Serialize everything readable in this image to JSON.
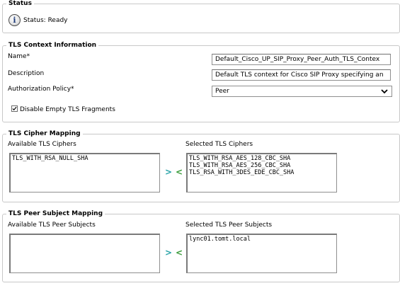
{
  "status": {
    "legend": "Status",
    "text": "Status: Ready",
    "icon": "info-icon"
  },
  "tls_context": {
    "legend": "TLS Context Information",
    "name_label": "Name",
    "name_value": "Default_Cisco_UP_SIP_Proxy_Peer_Auth_TLS_Contex",
    "description_label": "Description",
    "description_value": "Default TLS context for Cisco SIP Proxy specifying an",
    "auth_policy_label": "Authorization Policy",
    "auth_policy_value": "Peer",
    "required_marker": "*",
    "disable_empty_fragments_label": "Disable Empty TLS Fragments",
    "disable_empty_fragments_checked": true
  },
  "cipher_mapping": {
    "legend": "TLS Cipher Mapping",
    "available_label": "Available TLS Ciphers",
    "available": [
      "TLS_WITH_RSA_NULL_SHA"
    ],
    "selected_label": "Selected TLS Ciphers",
    "selected": [
      "TLS_WITH_RSA_AES_128_CBC_SHA",
      "TLS_WITH_RSA_AES_256_CBC_SHA",
      "TLS_RSA_WITH_3DES_EDE_CBC_SHA"
    ],
    "move_right": ">",
    "move_left": "<"
  },
  "peer_subject_mapping": {
    "legend": "TLS Peer Subject Mapping",
    "available_label": "Available TLS Peer Subjects",
    "available": [],
    "selected_label": "Selected TLS Peer Subjects",
    "selected": [
      "lync01.tomt.local"
    ],
    "move_right": ">",
    "move_left": "<"
  },
  "colors": {
    "arrow_right": "#2aa3a8",
    "arrow_left": "#3a9b3a",
    "border": "#c8c8c8"
  }
}
